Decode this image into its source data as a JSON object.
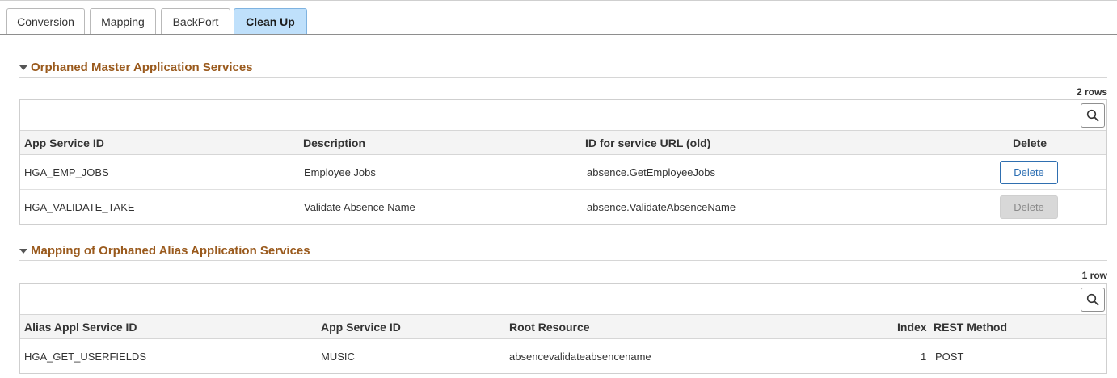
{
  "tabs": [
    {
      "label": "Conversion",
      "active": false
    },
    {
      "label": "Mapping",
      "active": false
    },
    {
      "label": "BackPort",
      "active": false
    },
    {
      "label": "Clean Up",
      "active": true
    }
  ],
  "colors": {
    "section_title": "#9a5a1d",
    "active_tab": "#bfe0fb",
    "button_text": "#2a6db2"
  },
  "orphaned_master": {
    "title": "Orphaned Master Application Services",
    "row_count": "2 rows",
    "search_icon": "magnifier-icon",
    "columns": {
      "app_service_id": "App Service ID",
      "description": "Description",
      "service_url": "ID for service URL (old)",
      "delete": "Delete"
    },
    "rows": [
      {
        "app_service_id": "HGA_EMP_JOBS",
        "description": "Employee Jobs",
        "service_url": "absence.GetEmployeeJobs",
        "delete_label": "Delete",
        "delete_enabled": true
      },
      {
        "app_service_id": "HGA_VALIDATE_TAKE",
        "description": "Validate Absence Name",
        "service_url": "absence.ValidateAbsenceName",
        "delete_label": "Delete",
        "delete_enabled": false
      }
    ]
  },
  "orphaned_alias": {
    "title": "Mapping of Orphaned Alias Application Services",
    "row_count": "1 row",
    "search_icon": "magnifier-icon",
    "columns": {
      "alias_id": "Alias Appl Service ID",
      "app_service_id": "App Service ID",
      "root_resource": "Root Resource",
      "index": "Index",
      "rest_method": "REST Method"
    },
    "rows": [
      {
        "alias_id": "HGA_GET_USERFIELDS",
        "app_service_id": "MUSIC",
        "root_resource": "absencevalidateabsencename",
        "index": "1",
        "rest_method": "POST"
      }
    ]
  }
}
